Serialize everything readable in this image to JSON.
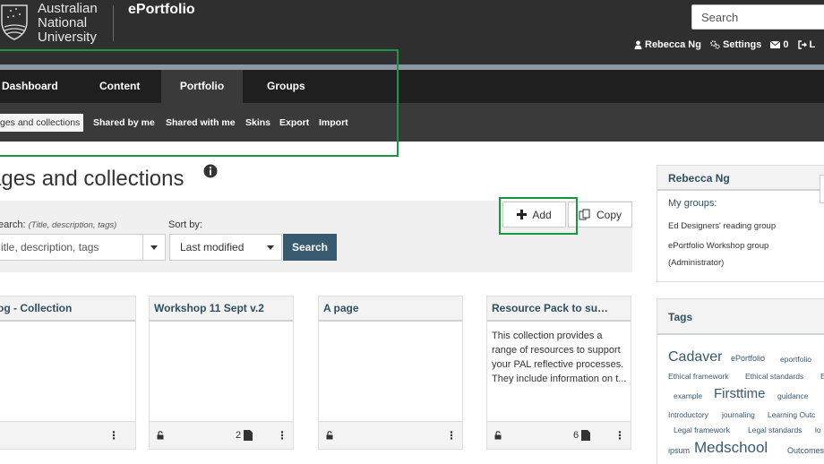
{
  "header": {
    "logo_lines": [
      "Australian",
      "National",
      "University"
    ],
    "app_title": "ePortfolio",
    "search_placeholder": "Search",
    "user_name": "Rebecca Ng",
    "settings_label": "Settings",
    "inbox_count": "0",
    "logout_label": "L"
  },
  "nav": {
    "tabs": [
      "Dashboard",
      "Content",
      "Portfolio",
      "Groups"
    ],
    "active_tab": "Portfolio",
    "subnav": [
      "ges and collections",
      "Shared by me",
      "Shared with me",
      "Skins",
      "Export",
      "Import"
    ]
  },
  "main": {
    "title": "ages and collections",
    "search_label": "earch:",
    "search_hint": "(Title, description, tags)",
    "sort_label": "Sort by:",
    "query_placeholder": "itle, description, tags",
    "sort_value": "Last modified",
    "search_button": "Search",
    "add_button": "Add",
    "copy_button": "Copy"
  },
  "cards": [
    {
      "title": "og - Collection",
      "description": "",
      "count": ""
    },
    {
      "title": "Workshop 11 Sept v.2",
      "description": "",
      "count": "2"
    },
    {
      "title": "A page",
      "description": "",
      "count": ""
    },
    {
      "title": "Resource Pack to su…",
      "description": "This collection provides a range of resources to support your PAL reflective processes. They include information on t...",
      "count": "6"
    }
  ],
  "sidebar": {
    "profile_name": "Rebecca Ng",
    "groups_label": "My groups:",
    "groups": [
      "Ed Designers' reading group",
      "ePortfolio Workshop group",
      "(Administrator)"
    ],
    "tags_title": "Tags",
    "tags": [
      "Cadaver",
      "ePortfolio",
      "eportfolio",
      "Ethical framework",
      "Ethical standards",
      "E",
      "example",
      "Firsttime",
      "guidance",
      "Introductory",
      "journaling",
      "Learning Outc",
      "Legal framework",
      "Legal standards",
      "lo",
      "ipsum",
      "Medschool",
      "Outcomes"
    ]
  },
  "colors": {
    "header_bg": "#2f2f2f",
    "nav_bg": "#1f1f1f",
    "subnav_bg": "#3a3a3a",
    "accent": "#375a6e",
    "highlight": "#1a9641"
  }
}
